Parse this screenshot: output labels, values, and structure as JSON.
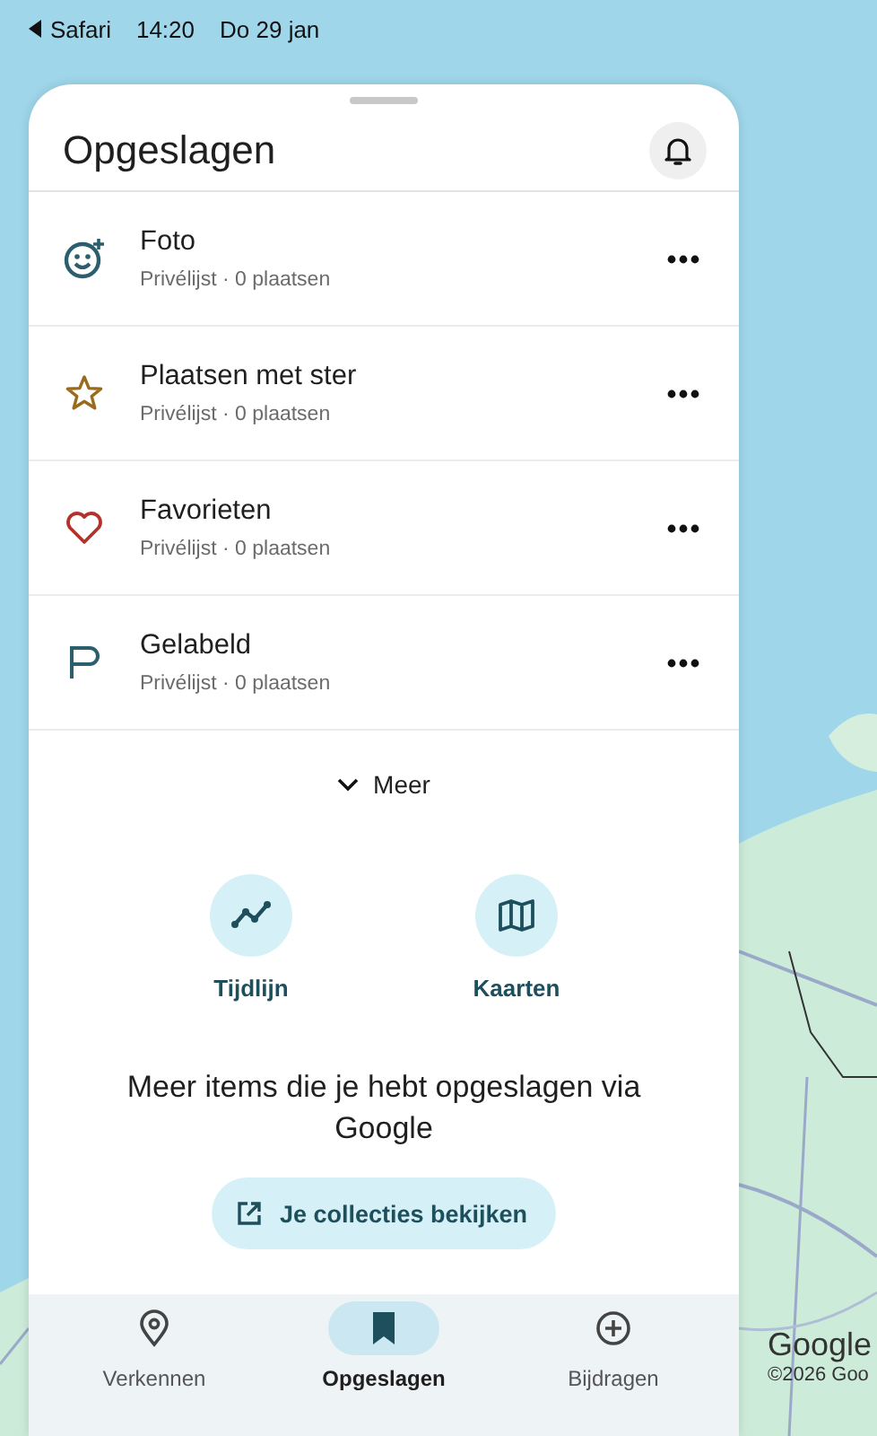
{
  "status_bar": {
    "back_app": "Safari",
    "time": "14:20",
    "date": "Do 29 jan"
  },
  "sheet": {
    "title": "Opgeslagen",
    "lists": [
      {
        "title": "Foto",
        "subtitle": "Privélijst · 0 plaatsen"
      },
      {
        "kind": "star",
        "title": "Plaatsen met ster",
        "subtitle": "Privélijst · 0 plaatsen"
      },
      {
        "kind": "heart",
        "title": "Favorieten",
        "subtitle": "Privélijst · 0 plaatsen"
      },
      {
        "kind": "flag",
        "title": "Gelabeld",
        "subtitle": "Privélijst · 0 plaatsen"
      }
    ],
    "more": "Meer",
    "shortcuts": [
      {
        "kind": "timeline",
        "label": "Tijdlijn"
      },
      {
        "kind": "map",
        "label": "Kaarten"
      }
    ],
    "promo": {
      "text": "Meer items die je hebt opgeslagen via Google",
      "button": "Je collecties bekijken"
    }
  },
  "bottom_nav": [
    {
      "kind": "explore",
      "label": "Verkennen",
      "selected": false
    },
    {
      "kind": "saved",
      "label": "Opgeslagen",
      "selected": true
    },
    {
      "kind": "contribute",
      "label": "Bijdragen",
      "selected": false
    }
  ],
  "map_attribution": {
    "logo": "Google",
    "copyright": "©2026 Goo"
  }
}
